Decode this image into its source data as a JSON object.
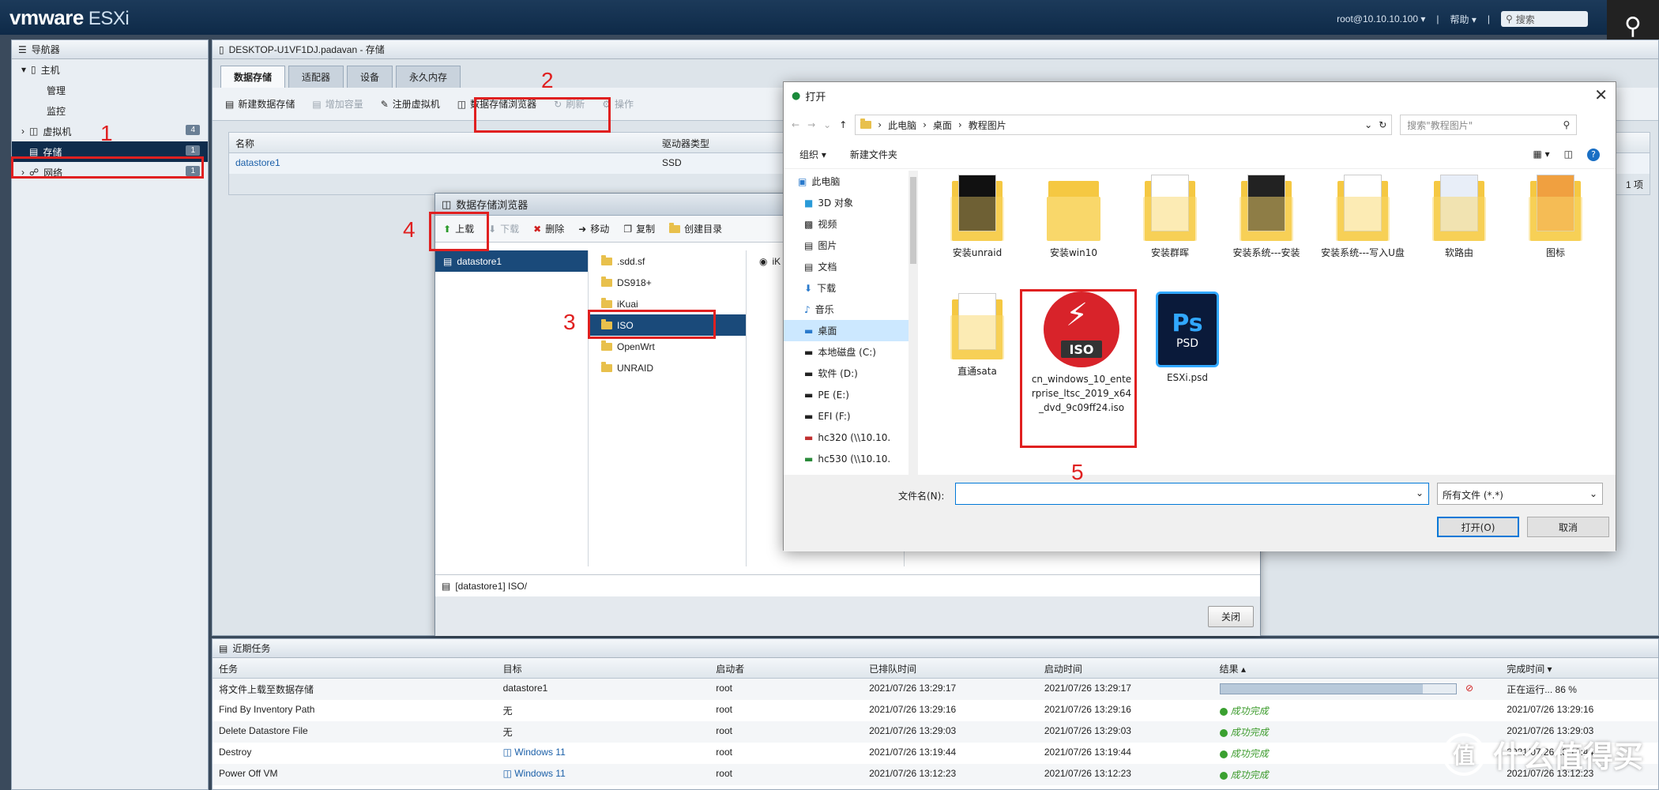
{
  "topbar": {
    "brand": "vmware",
    "product": "ESXi",
    "user": "root@10.10.10.100 ▾",
    "help": "帮助 ▾",
    "search_placeholder": "搜索"
  },
  "navigator": {
    "title": "导航器",
    "items": [
      {
        "label": "主机",
        "count": ""
      },
      {
        "label": "管理",
        "count": ""
      },
      {
        "label": "监控",
        "count": ""
      },
      {
        "label": "虚拟机",
        "count": "4"
      },
      {
        "label": "存储",
        "count": "1"
      },
      {
        "label": "网络",
        "count": "1"
      }
    ]
  },
  "main": {
    "title": "DESKTOP-U1VF1DJ.padavan - 存储",
    "tabs": [
      "数据存储",
      "适配器",
      "设备",
      "永久内存"
    ],
    "toolbar": [
      "新建数据存储",
      "增加容量",
      "注册虚拟机",
      "数据存储浏览器",
      "刷新",
      "操作"
    ],
    "grid_headers": [
      "名称",
      "驱动器类型"
    ],
    "grid_rows": [
      {
        "name": "datastore1",
        "type": "SSD"
      }
    ],
    "grid_count": "1 项"
  },
  "datastore_browser": {
    "title": "数据存储浏览器",
    "toolbar": [
      "上载",
      "下载",
      "删除",
      "移动",
      "复制",
      "创建目录"
    ],
    "datastores": [
      "datastore1"
    ],
    "folders": [
      ".sdd.sf",
      "DS918+",
      "iKuai",
      "ISO",
      "OpenWrt",
      "UNRAID"
    ],
    "selected_folder": "ISO",
    "third_col_item": "iK",
    "path": "[datastore1] ISO/",
    "close": "关闭"
  },
  "open_dialog": {
    "title": "打开",
    "breadcrumb": [
      "此电脑",
      "桌面",
      "教程图片"
    ],
    "search_placeholder": "搜索\"教程图片\"",
    "cmd_organize": "组织 ▾",
    "cmd_new_folder": "新建文件夹",
    "sidebar": [
      "此电脑",
      "3D 对象",
      "视频",
      "图片",
      "文档",
      "下载",
      "音乐",
      "桌面",
      "本地磁盘 (C:)",
      "软件 (D:)",
      "PE (E:)",
      "EFI (F:)",
      "hc320 (\\\\10.10.",
      "hc530 (\\\\10.10."
    ],
    "selected_sidebar": "桌面",
    "files": [
      "安装unraid",
      "安装win10",
      "安装群晖",
      "安装系统---安装",
      "安装系统---写入U盘",
      "软路由",
      "图标",
      "直通sata",
      "cn_windows_10_enterprise_ltsc_2019_x64_dvd_9c09ff24.iso",
      "ESXi.psd"
    ],
    "filename_label": "文件名(N):",
    "filename_value": "",
    "filter": "所有文件 (*.*)",
    "open_button": "打开(O)",
    "cancel_button": "取消",
    "iso_badge": "ISO",
    "psd_label": "Ps",
    "psd_sub": "PSD"
  },
  "recent_tasks": {
    "title": "近期任务",
    "headers": [
      "任务",
      "目标",
      "启动者",
      "已排队时间",
      "启动时间",
      "结果 ▴",
      "完成时间 ▾"
    ],
    "rows": [
      {
        "task": "将文件上载至数据存储",
        "target": "datastore1",
        "initiator": "root",
        "queued": "2021/07/26 13:29:17",
        "started": "2021/07/26 13:29:17",
        "result": "",
        "completed": "正在运行... 86 %"
      },
      {
        "task": "Find By Inventory Path",
        "target": "无",
        "initiator": "root",
        "queued": "2021/07/26 13:29:16",
        "started": "2021/07/26 13:29:16",
        "result": "成功完成",
        "completed": "2021/07/26 13:29:16"
      },
      {
        "task": "Delete Datastore File",
        "target": "无",
        "initiator": "root",
        "queued": "2021/07/26 13:29:03",
        "started": "2021/07/26 13:29:03",
        "result": "成功完成",
        "completed": "2021/07/26 13:29:03"
      },
      {
        "task": "Destroy",
        "target": "Windows 11",
        "initiator": "root",
        "queued": "2021/07/26 13:19:44",
        "started": "2021/07/26 13:19:44",
        "result": "成功完成",
        "completed": "2021/07/26 13:19:44"
      },
      {
        "task": "Power Off VM",
        "target": "Windows 11",
        "initiator": "root",
        "queued": "2021/07/26 13:12:23",
        "started": "2021/07/26 13:12:23",
        "result": "成功完成",
        "completed": "2021/07/26 13:12:23"
      }
    ],
    "upload_progress": 0.86
  },
  "annotations": [
    "1",
    "2",
    "3",
    "4",
    "5"
  ],
  "watermark": "什么值得买",
  "watermark_logo": "值",
  "colors": {
    "annotation": "#e02020",
    "selected": "#0f2c4c",
    "success": "#3a9a2a"
  }
}
